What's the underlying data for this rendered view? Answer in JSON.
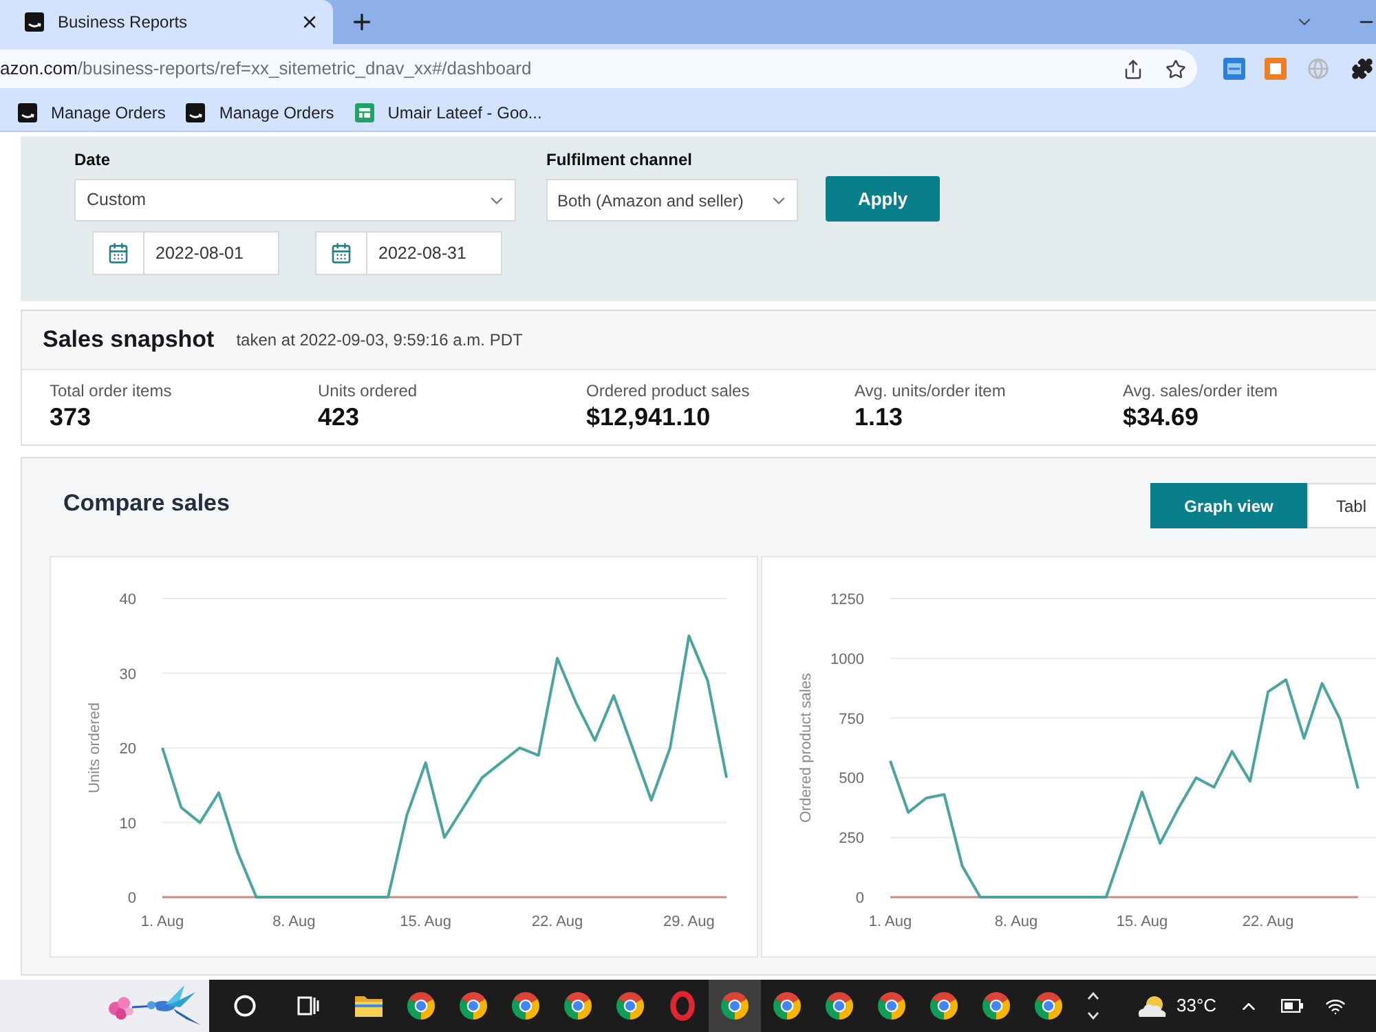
{
  "browser": {
    "tab_title": "Business Reports",
    "url": {
      "host": "azon.com",
      "path": "/business-reports/ref=xx_sitemetric_dnav_xx#/dashboard"
    },
    "bookmarks": [
      {
        "kind": "amazon",
        "label": "Manage Orders"
      },
      {
        "kind": "amazon",
        "label": "Manage Orders"
      },
      {
        "kind": "sheets",
        "label": "Umair Lateef - Goo..."
      }
    ]
  },
  "filters": {
    "date": {
      "label": "Date",
      "value": "Custom",
      "start_date": "2022-08-01",
      "end_date": "2022-08-31"
    },
    "fulfilment_channel": {
      "label": "Fulfilment channel",
      "value": "Both (Amazon and seller)"
    },
    "apply_button": "Apply"
  },
  "sales_snapshot": {
    "title": "Sales snapshot",
    "taken_at": "taken at 2022-09-03, 9:59:16 a.m. PDT",
    "metrics": [
      {
        "label": "Total order items",
        "value": "373"
      },
      {
        "label": "Units ordered",
        "value": "423"
      },
      {
        "label": "Ordered product sales",
        "value": "$12,941.10"
      },
      {
        "label": "Avg. units/order item",
        "value": "1.13"
      },
      {
        "label": "Avg. sales/order item",
        "value": "$34.69"
      }
    ]
  },
  "compare_sales": {
    "title": "Compare sales",
    "views": [
      {
        "label": "Graph view",
        "selected": true
      },
      {
        "label": "Tabl",
        "selected": false
      }
    ],
    "chart_data": [
      {
        "type": "line",
        "ylabel": "Units ordered",
        "x": [
          "--08-01",
          "--08-02",
          "--08-03",
          "--08-04",
          "--08-05",
          "--08-06",
          "--08-07",
          "--08-08",
          "--08-09",
          "--08-10",
          "--08-11",
          "--08-12",
          "--08-13",
          "--08-14",
          "--08-15",
          "--08-16",
          "--08-17",
          "--08-18",
          "--08-19",
          "--08-20",
          "--08-21",
          "--08-22",
          "--08-23",
          "--08-24",
          "--08-25",
          "--08-26",
          "--08-27",
          "--08-28",
          "--08-29",
          "--08-30",
          "--08-31"
        ],
        "xlim": [
          "--08-01",
          "--08-31"
        ],
        "ylim": [
          0,
          40
        ],
        "yticks": [
          0,
          10,
          20,
          30,
          40
        ],
        "xticks": [
          {
            "value": "--08-01",
            "label": "1. Aug"
          },
          {
            "value": "--08-08",
            "label": "8. Aug"
          },
          {
            "value": "--08-15",
            "label": "15. Aug"
          },
          {
            "value": "--08-22",
            "label": "22. Aug"
          },
          {
            "value": "--08-29",
            "label": "29. Aug"
          }
        ],
        "grid": true,
        "series": [
          {
            "color": "#4aa5a0",
            "values": [
              20,
              12,
              10,
              14,
              6,
              0,
              0,
              0,
              0,
              0,
              0,
              0,
              0,
              11,
              18,
              8,
              12,
              16,
              18,
              20,
              19,
              32,
              26,
              21,
              27,
              20,
              13,
              20,
              35,
              29,
              16
            ]
          },
          {
            "color": "#cc8a86",
            "values": [
              0,
              0,
              0,
              0,
              0,
              0,
              0,
              0,
              0,
              0,
              0,
              0,
              0,
              0,
              0,
              0,
              0,
              0,
              0,
              0,
              0,
              0,
              0,
              0,
              0,
              0,
              0,
              0,
              0,
              0,
              0
            ]
          }
        ]
      },
      {
        "type": "line",
        "ylabel": "Ordered product sales",
        "x": [
          "--08-01",
          "--08-02",
          "--08-03",
          "--08-04",
          "--08-05",
          "--08-06",
          "--08-07",
          "--08-08",
          "--08-09",
          "--08-10",
          "--08-11",
          "--08-12",
          "--08-13",
          "--08-14",
          "--08-15",
          "--08-16",
          "--08-17",
          "--08-18",
          "--08-19",
          "--08-20",
          "--08-21",
          "--08-22",
          "--08-23",
          "--08-24",
          "--08-25",
          "--08-26",
          "--08-27"
        ],
        "xlim": [
          "--08-01",
          "--08-28"
        ],
        "ylim": [
          0,
          1250
        ],
        "yticks": [
          0,
          250,
          500,
          750,
          1000,
          1250
        ],
        "xticks": [
          {
            "value": "--08-01",
            "label": "1. Aug"
          },
          {
            "value": "--08-08",
            "label": "8. Aug"
          },
          {
            "value": "--08-15",
            "label": "15. Aug"
          },
          {
            "value": "--08-22",
            "label": "22. Aug"
          }
        ],
        "grid": true,
        "series": [
          {
            "color": "#4aa5a0",
            "values": [
              570,
              355,
              415,
              430,
              130,
              0,
              0,
              0,
              0,
              0,
              0,
              0,
              0,
              220,
              440,
              225,
              370,
              500,
              460,
              610,
              485,
              860,
              910,
              665,
              895,
              745,
              455
            ]
          },
          {
            "color": "#cc8a86",
            "values": [
              0,
              0,
              0,
              0,
              0,
              0,
              0,
              0,
              0,
              0,
              0,
              0,
              0,
              0,
              0,
              0,
              0,
              0,
              0,
              0,
              0,
              0,
              0,
              0,
              0,
              0,
              0
            ]
          }
        ]
      }
    ]
  },
  "taskbar": {
    "apps": [
      {
        "kind": "cortana",
        "selected": false
      },
      {
        "kind": "task_view",
        "selected": false
      },
      {
        "kind": "folder",
        "selected": false
      },
      {
        "kind": "chrome",
        "selected": false
      },
      {
        "kind": "chrome",
        "selected": false
      },
      {
        "kind": "chrome",
        "selected": false
      },
      {
        "kind": "chrome",
        "selected": false
      },
      {
        "kind": "chrome",
        "selected": false
      },
      {
        "kind": "opera",
        "selected": false
      },
      {
        "kind": "chrome",
        "selected": true
      },
      {
        "kind": "chrome",
        "selected": false
      },
      {
        "kind": "chrome",
        "selected": false
      },
      {
        "kind": "chrome",
        "selected": false
      },
      {
        "kind": "chrome",
        "selected": false
      },
      {
        "kind": "chrome",
        "selected": false
      },
      {
        "kind": "chrome",
        "selected": false
      }
    ],
    "temperature": "33°C"
  }
}
